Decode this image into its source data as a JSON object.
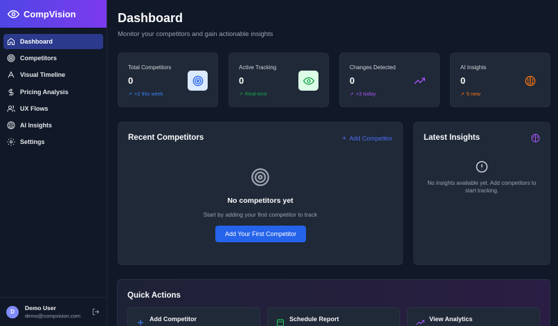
{
  "brand": {
    "name": "CompVision"
  },
  "nav": [
    {
      "label": "Dashboard",
      "icon": "home-icon",
      "active": true
    },
    {
      "label": "Competitors",
      "icon": "target-icon"
    },
    {
      "label": "Visual Timeline",
      "icon": "timeline-icon"
    },
    {
      "label": "Pricing Analysis",
      "icon": "dollar-icon"
    },
    {
      "label": "UX Flows",
      "icon": "users-icon"
    },
    {
      "label": "AI Insights",
      "icon": "brain-icon"
    },
    {
      "label": "Settings",
      "icon": "gear-icon"
    }
  ],
  "user": {
    "initial": "D",
    "name": "Demo User",
    "email": "demo@compvision.com"
  },
  "page": {
    "title": "Dashboard",
    "subtitle": "Monitor your competitors and gain actionable insights"
  },
  "stats": [
    {
      "label": "Total Competitors",
      "value": "0",
      "trend": "+2 this week",
      "color": "#3b82f6",
      "icon": "target-icon"
    },
    {
      "label": "Active Tracking",
      "value": "0",
      "trend": "Real-time",
      "color": "#16a34a",
      "icon": "eye-icon"
    },
    {
      "label": "Changes Detected",
      "value": "0",
      "trend": "+3 today",
      "color": "#a855f7",
      "icon": "trending-up-icon"
    },
    {
      "label": "AI Insights",
      "value": "0",
      "trend": "5 new",
      "color": "#f97316",
      "icon": "brain-icon"
    }
  ],
  "recent": {
    "title": "Recent Competitors",
    "add_label": "Add Competitor",
    "empty_title": "No competitors yet",
    "empty_sub": "Start by adding your first competitor to track",
    "cta": "Add Your First Competitor"
  },
  "insights": {
    "title": "Latest Insights",
    "empty": "No insights available yet. Add competitors to start tracking."
  },
  "quick": {
    "title": "Quick Actions",
    "actions": [
      {
        "label": "Add Competitor",
        "icon": "plus-icon"
      },
      {
        "label": "Schedule Report",
        "icon": "calendar-icon"
      },
      {
        "label": "View Analytics",
        "icon": "trending-up-icon"
      }
    ]
  }
}
